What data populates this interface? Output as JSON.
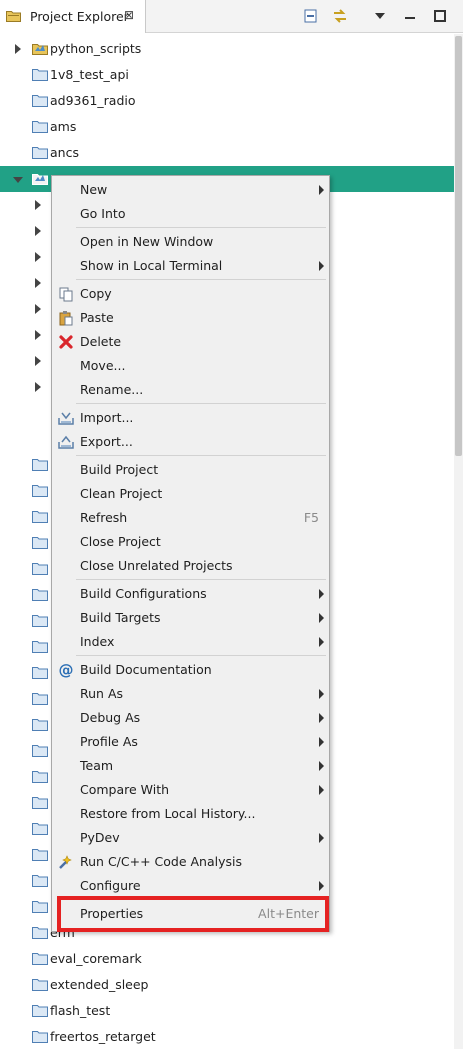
{
  "view": {
    "title": "Project Explorer",
    "close_glyph": "⊠"
  },
  "tree": {
    "items": [
      {
        "label": "python_scripts",
        "icon": "project-folder-icon",
        "twisty": "collapsed"
      },
      {
        "label": "1v8_test_api",
        "icon": "folder-icon",
        "twisty": "none"
      },
      {
        "label": "ad9361_radio",
        "icon": "folder-icon",
        "twisty": "none"
      },
      {
        "label": "ams",
        "icon": "folder-icon",
        "twisty": "none"
      },
      {
        "label": "ancs",
        "icon": "folder-icon",
        "twisty": "none"
      },
      {
        "label": "",
        "icon": "project-folder-icon",
        "twisty": "expanded",
        "selected": true
      }
    ],
    "bottom_items": [
      {
        "label": "erm",
        "icon": "folder-icon"
      },
      {
        "label": "eval_coremark",
        "icon": "folder-icon"
      },
      {
        "label": "extended_sleep",
        "icon": "folder-icon"
      },
      {
        "label": "flash_test",
        "icon": "folder-icon"
      },
      {
        "label": "freertos_retarget",
        "icon": "folder-icon"
      }
    ]
  },
  "context_menu": {
    "groups": [
      [
        {
          "label": "New",
          "submenu": true
        },
        {
          "label": "Go Into"
        }
      ],
      [
        {
          "label": "Open in New Window"
        },
        {
          "label": "Show in Local Terminal",
          "submenu": true
        }
      ],
      [
        {
          "label": "Copy",
          "icon": "copy-icon"
        },
        {
          "label": "Paste",
          "icon": "paste-icon"
        },
        {
          "label": "Delete",
          "icon": "delete-icon"
        },
        {
          "label": "Move..."
        },
        {
          "label": "Rename..."
        }
      ],
      [
        {
          "label": "Import...",
          "icon": "import-icon"
        },
        {
          "label": "Export...",
          "icon": "export-icon"
        }
      ],
      [
        {
          "label": "Build Project"
        },
        {
          "label": "Clean Project"
        },
        {
          "label": "Refresh",
          "shortcut": "F5"
        },
        {
          "label": "Close Project"
        },
        {
          "label": "Close Unrelated Projects"
        }
      ],
      [
        {
          "label": "Build Configurations",
          "submenu": true
        },
        {
          "label": "Build Targets",
          "submenu": true
        },
        {
          "label": "Index",
          "submenu": true
        }
      ],
      [
        {
          "label": "Build Documentation",
          "icon": "at-icon"
        },
        {
          "label": "Run As",
          "submenu": true
        },
        {
          "label": "Debug As",
          "submenu": true
        },
        {
          "label": "Profile As",
          "submenu": true
        },
        {
          "label": "Team",
          "submenu": true
        },
        {
          "label": "Compare With",
          "submenu": true
        },
        {
          "label": "Restore from Local History..."
        },
        {
          "label": "PyDev",
          "submenu": true
        },
        {
          "label": "Run C/C++ Code Analysis",
          "icon": "code-analysis-icon"
        },
        {
          "label": "Configure",
          "submenu": true
        }
      ],
      [
        {
          "label": "Properties",
          "shortcut": "Alt+Enter",
          "highlighted": true
        }
      ]
    ]
  },
  "colors": {
    "selection": "#21a186",
    "highlight_box": "#e52222",
    "menu_bg": "#f0f0f0"
  }
}
